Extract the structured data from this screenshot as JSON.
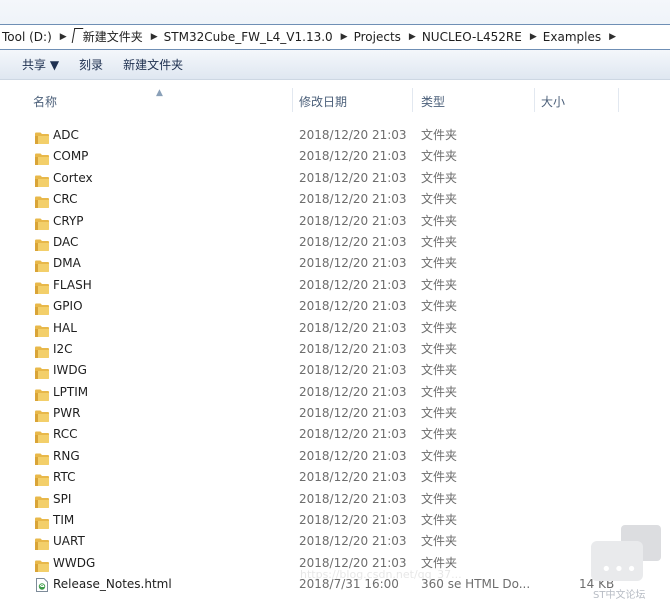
{
  "address": {
    "crumbs": [
      "Tool (D:)",
      "新建文件夹",
      "STM32Cube_FW_L4_V1.13.0",
      "Projects",
      "NUCLEO-L452RE",
      "Examples"
    ]
  },
  "toolbar": {
    "share_label": "共享 ▼",
    "burn_label": "刻录",
    "new_folder_label": "新建文件夹"
  },
  "columns": {
    "name": "名称",
    "date": "修改日期",
    "type": "类型",
    "size": "大小"
  },
  "files": [
    {
      "name": "ADC",
      "date": "2018/12/20 21:03",
      "type": "文件夹",
      "size": "",
      "icon": "folder-icon"
    },
    {
      "name": "COMP",
      "date": "2018/12/20 21:03",
      "type": "文件夹",
      "size": "",
      "icon": "folder-icon"
    },
    {
      "name": "Cortex",
      "date": "2018/12/20 21:03",
      "type": "文件夹",
      "size": "",
      "icon": "folder-icon"
    },
    {
      "name": "CRC",
      "date": "2018/12/20 21:03",
      "type": "文件夹",
      "size": "",
      "icon": "folder-icon"
    },
    {
      "name": "CRYP",
      "date": "2018/12/20 21:03",
      "type": "文件夹",
      "size": "",
      "icon": "folder-icon"
    },
    {
      "name": "DAC",
      "date": "2018/12/20 21:03",
      "type": "文件夹",
      "size": "",
      "icon": "folder-icon"
    },
    {
      "name": "DMA",
      "date": "2018/12/20 21:03",
      "type": "文件夹",
      "size": "",
      "icon": "folder-icon"
    },
    {
      "name": "FLASH",
      "date": "2018/12/20 21:03",
      "type": "文件夹",
      "size": "",
      "icon": "folder-icon"
    },
    {
      "name": "GPIO",
      "date": "2018/12/20 21:03",
      "type": "文件夹",
      "size": "",
      "icon": "folder-icon"
    },
    {
      "name": "HAL",
      "date": "2018/12/20 21:03",
      "type": "文件夹",
      "size": "",
      "icon": "folder-icon"
    },
    {
      "name": "I2C",
      "date": "2018/12/20 21:03",
      "type": "文件夹",
      "size": "",
      "icon": "folder-icon"
    },
    {
      "name": "IWDG",
      "date": "2018/12/20 21:03",
      "type": "文件夹",
      "size": "",
      "icon": "folder-icon"
    },
    {
      "name": "LPTIM",
      "date": "2018/12/20 21:03",
      "type": "文件夹",
      "size": "",
      "icon": "folder-icon"
    },
    {
      "name": "PWR",
      "date": "2018/12/20 21:03",
      "type": "文件夹",
      "size": "",
      "icon": "folder-icon"
    },
    {
      "name": "RCC",
      "date": "2018/12/20 21:03",
      "type": "文件夹",
      "size": "",
      "icon": "folder-icon"
    },
    {
      "name": "RNG",
      "date": "2018/12/20 21:03",
      "type": "文件夹",
      "size": "",
      "icon": "folder-icon"
    },
    {
      "name": "RTC",
      "date": "2018/12/20 21:03",
      "type": "文件夹",
      "size": "",
      "icon": "folder-icon"
    },
    {
      "name": "SPI",
      "date": "2018/12/20 21:03",
      "type": "文件夹",
      "size": "",
      "icon": "folder-icon"
    },
    {
      "name": "TIM",
      "date": "2018/12/20 21:03",
      "type": "文件夹",
      "size": "",
      "icon": "folder-icon"
    },
    {
      "name": "UART",
      "date": "2018/12/20 21:03",
      "type": "文件夹",
      "size": "",
      "icon": "folder-icon"
    },
    {
      "name": "WWDG",
      "date": "2018/12/20 21:03",
      "type": "文件夹",
      "size": "",
      "icon": "folder-icon"
    },
    {
      "name": "Release_Notes.html",
      "date": "2018/7/31 16:00",
      "type": "360 se HTML Do...",
      "size": "14 KB",
      "icon": "html-file-icon"
    }
  ],
  "watermark": "https://blog.csdn.net/qq_37...",
  "chat_widget": {
    "caption": "ST中文论坛",
    "icon": "chat-bubble-icon"
  },
  "colors": {
    "folder": "#e8b84a",
    "address_border": "#6f8fb5",
    "toolbar_text": "#1e3050"
  }
}
